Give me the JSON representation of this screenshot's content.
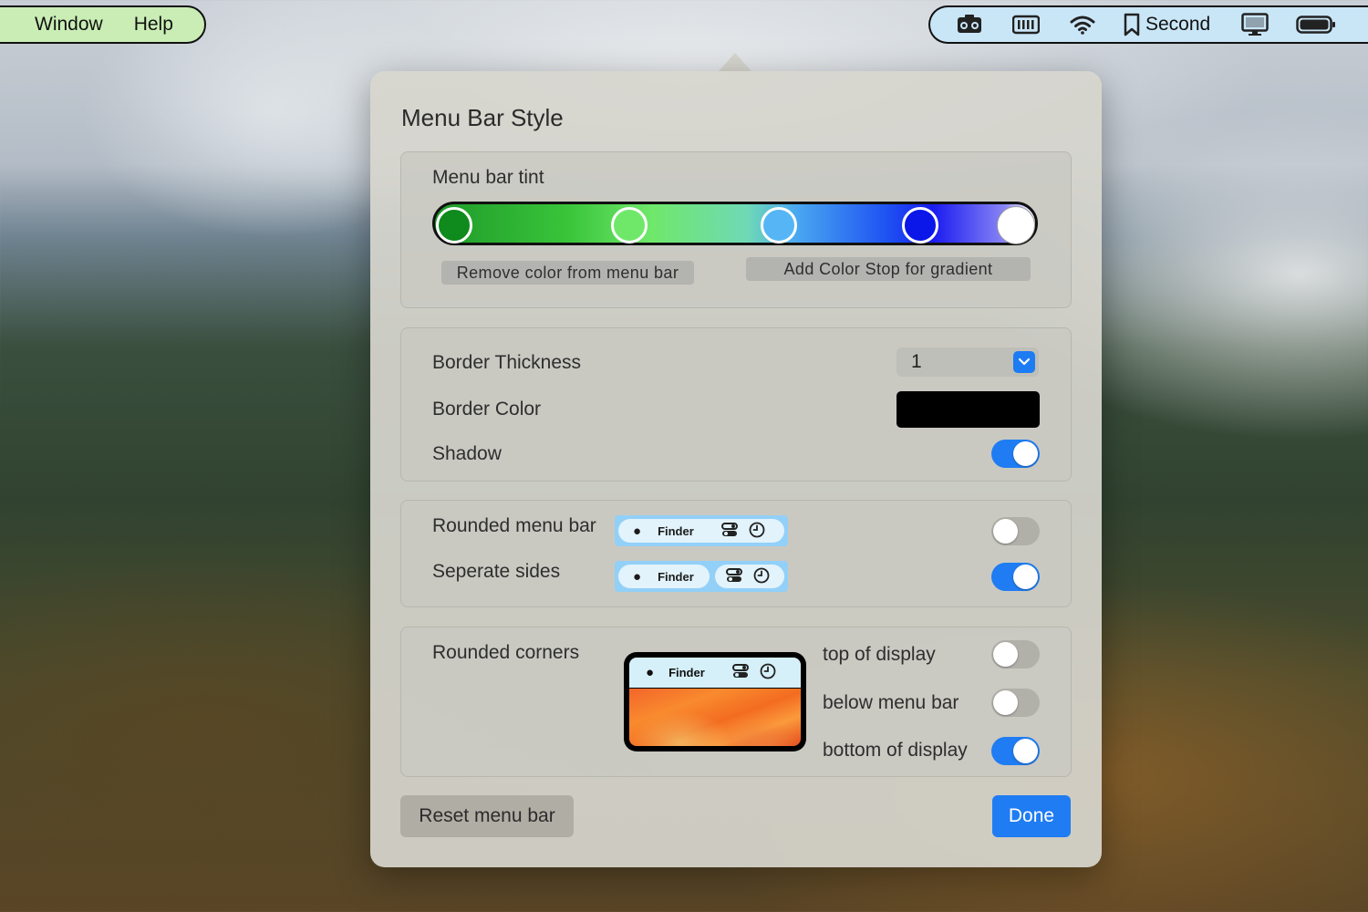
{
  "menubar": {
    "left_items": [
      "Window",
      "Help"
    ],
    "right_status": {
      "bookmark_label": "Second"
    }
  },
  "popover": {
    "title": "Menu Bar Style",
    "tint": {
      "label": "Menu bar tint",
      "color_stops": [
        "#0f8a1c",
        "#6fe86a",
        "#56b6f5",
        "#0a17e8",
        "#ffffff"
      ],
      "remove_button": "Remove color from menu bar",
      "add_button": "Add Color Stop for gradient"
    },
    "border": {
      "thickness_label": "Border Thickness",
      "thickness_value": "1",
      "color_label": "Border Color",
      "color_value": "#000000",
      "shadow_label": "Shadow",
      "shadow_on": true
    },
    "shape": {
      "rounded_label": "Rounded menu bar",
      "rounded_on": false,
      "separate_label": "Seperate sides",
      "separate_on": true,
      "preview_app": "Finder"
    },
    "corners": {
      "label": "Rounded corners",
      "preview_app": "Finder",
      "options": [
        {
          "label": "top of display",
          "on": false
        },
        {
          "label": "below menu bar",
          "on": false
        },
        {
          "label": "bottom of display",
          "on": true
        }
      ]
    },
    "reset_button": "Reset menu bar",
    "done_button": "Done"
  }
}
